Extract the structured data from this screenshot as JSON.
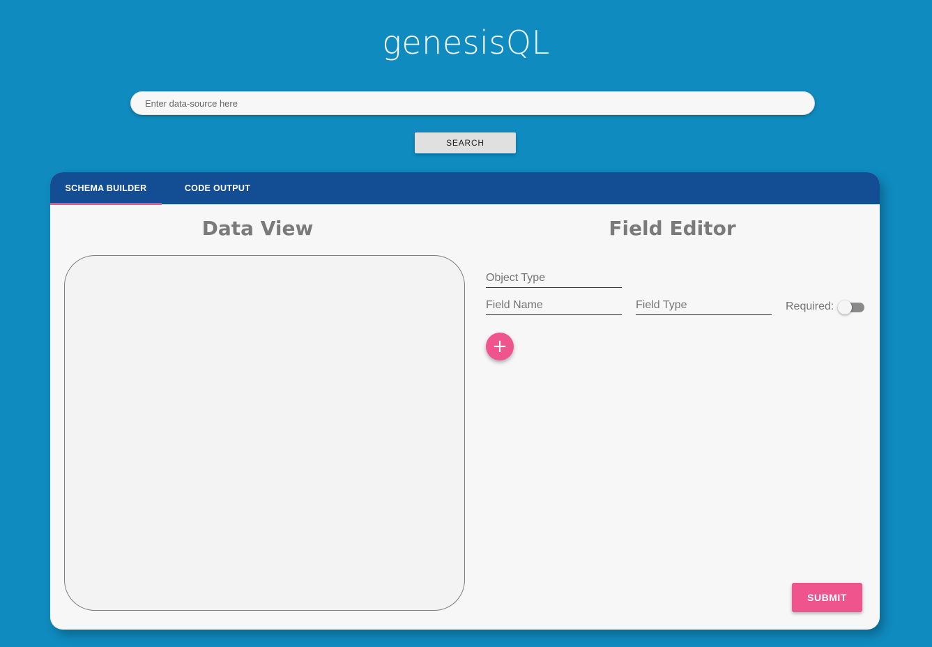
{
  "app": {
    "logo_prefix": "genesis",
    "logo_suffix": "QL"
  },
  "search": {
    "placeholder": "Enter data-source here",
    "button_label": "SEARCH"
  },
  "tabs": [
    {
      "label": "SCHEMA BUILDER",
      "active": true
    },
    {
      "label": "CODE OUTPUT",
      "active": false
    }
  ],
  "data_view": {
    "title": "Data View"
  },
  "field_editor": {
    "title": "Field Editor",
    "object_type_placeholder": "Object Type",
    "field_name_placeholder": "Field Name",
    "field_type_placeholder": "Field Type",
    "required_label": "Required:",
    "required_on": false,
    "add_icon": "plus-icon",
    "add_symbol": "+",
    "submit_label": "SUBMIT"
  },
  "colors": {
    "background": "#0f8bbf",
    "tabbar": "#134e94",
    "accent": "#f0548c"
  }
}
